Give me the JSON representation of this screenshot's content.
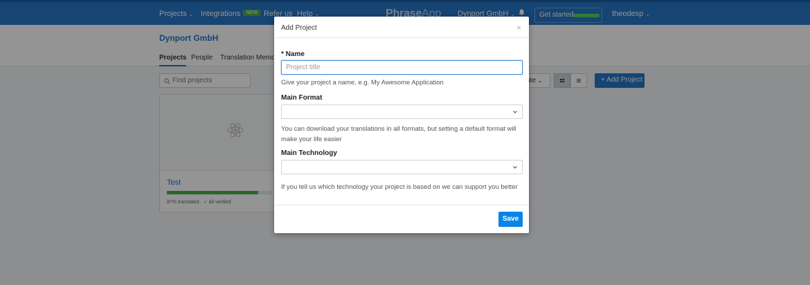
{
  "navbar": {
    "projects": "Projects",
    "integrations": "Integrations",
    "integrations_badge": "NEW",
    "refer": "Refer us",
    "help": "Help",
    "logo_a": "Phrase",
    "logo_b": "App",
    "org": "Dynport GmbH",
    "get_started": "Get started",
    "user": "theodesp",
    "caret": "⌄"
  },
  "org": {
    "title": "Dynport GmbH",
    "tabs": [
      "Projects",
      "People",
      "Translation Memory"
    ]
  },
  "toolbar": {
    "search_placeholder": "Find projects",
    "sort_label": "ate",
    "add_project": "+ Add Project"
  },
  "projects": [
    {
      "name": "Test",
      "progress": 0.87,
      "meta": "87% translated · ✓ All verified"
    }
  ],
  "modal": {
    "title": "Add Project",
    "close": "×",
    "name_label": "* Name",
    "name_placeholder": "Project title",
    "name_help": "Give your project a name, e.g. My Awesome Application",
    "format_label": "Main Format",
    "format_value": "",
    "format_help": "You can download your translations in all formats, but setting a default format will make your life easier",
    "tech_label": "Main Technology",
    "tech_value": "",
    "tech_help": "If you tell us which technology your project is based on we can support you better",
    "save": "Save"
  },
  "colors": {
    "primary": "#2676c6",
    "save": "#0a84e8",
    "progress": "#4cae4c"
  }
}
